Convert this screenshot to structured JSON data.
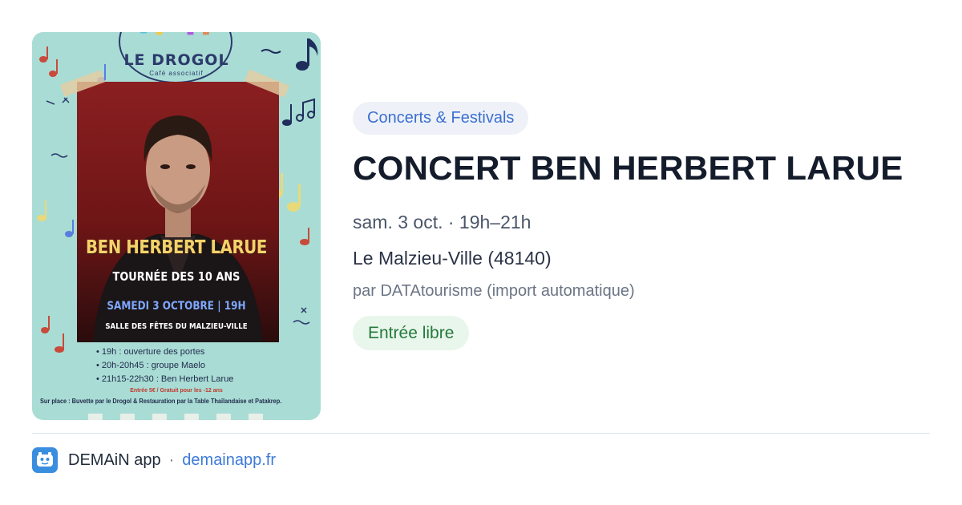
{
  "poster": {
    "logo_name": "LE DROGOL",
    "logo_sub": "Café associatif",
    "title": "BEN HERBERT LARUE",
    "tour": "TOURNÉE DES 10 ANS",
    "date": "SAMEDI 3 OCTOBRE | 19H",
    "venue": "SALLE DES FÊTES DU MALZIEU-VILLE",
    "program": [
      "19h : ouverture des portes",
      "20h-20h45 : groupe Maelo",
      "21h15-22h30 : Ben Herbert Larue"
    ],
    "price": "Entrée 5€ / Gratuit pour les -12 ans",
    "onsite": "Sur place : Buvette par le Drogol & Restauration par la Table Thaïlandaise et Patakrep."
  },
  "event": {
    "category": "Concerts & Festivals",
    "title": "CONCERT BEN HERBERT LARUE",
    "datetime": "sam. 3 oct. · 19h–21h",
    "location": "Le Malzieu-Ville (48140)",
    "author": "par DATAtourisme (import automatique)",
    "price": "Entrée libre"
  },
  "footer": {
    "app_name": "DEMAiN app",
    "separator": "·",
    "site": "demainapp.fr"
  },
  "colors": {
    "category_text": "#3d6fd0",
    "category_bg": "#eef2f8",
    "price_text": "#247a3c",
    "price_bg": "#e9f6ec",
    "link": "#3d7ad8",
    "app_icon": "#3a8ee0",
    "poster_bg": "#a9dcd5"
  },
  "icons": {
    "app": "app-logo-icon",
    "notes": "music-note-icon"
  }
}
